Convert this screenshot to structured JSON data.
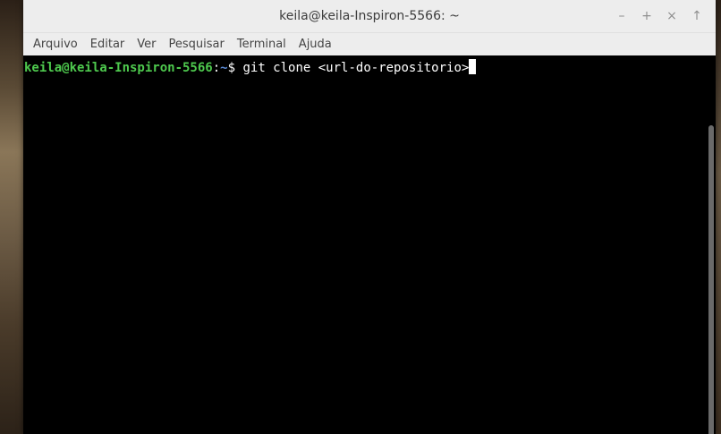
{
  "window": {
    "title": "keila@keila-Inspiron-5566: ~",
    "controls": {
      "minimize": "–",
      "maximize": "+",
      "close": "×",
      "pin": "↑"
    }
  },
  "menubar": {
    "items": [
      "Arquivo",
      "Editar",
      "Ver",
      "Pesquisar",
      "Terminal",
      "Ajuda"
    ]
  },
  "terminal": {
    "prompt_user_host": "keila@keila-Inspiron-5566",
    "prompt_colon": ":",
    "prompt_dir": "~",
    "prompt_symbol": "$",
    "command": " git clone <url-do-repositorio>"
  },
  "colors": {
    "prompt_user": "#4ec94e",
    "prompt_dir": "#5b8bd6",
    "terminal_bg": "#000000",
    "titlebar_bg": "#ededed"
  }
}
